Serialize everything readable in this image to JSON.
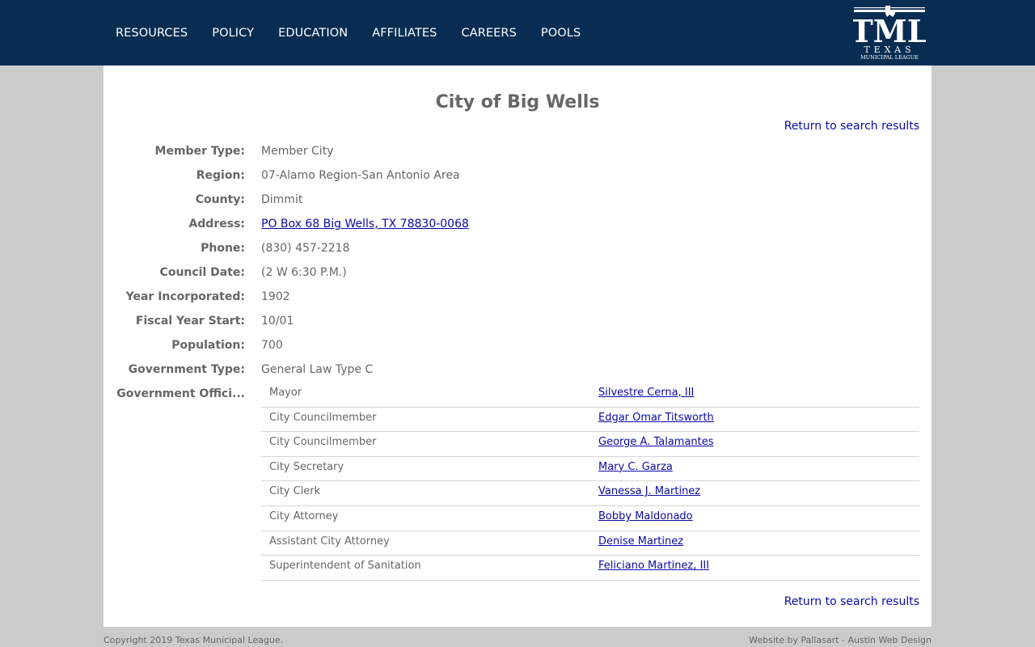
{
  "nav": {
    "items": [
      "RESOURCES",
      "POLICY",
      "EDUCATION",
      "AFFILIATES",
      "CAREERS",
      "POOLS"
    ]
  },
  "logo": {
    "main": "TML",
    "state": "TEXAS",
    "sub": "MUNICIPAL LEAGUE"
  },
  "page": {
    "title": "City of Big Wells",
    "return_link": "Return to search results"
  },
  "details": [
    {
      "label": "Member Type:",
      "value": "Member City"
    },
    {
      "label": "Region:",
      "value": "07-Alamo Region-San Antonio Area"
    },
    {
      "label": "County:",
      "value": "Dimmit"
    },
    {
      "label": "Address:",
      "value": "PO Box 68 Big Wells, TX 78830-0068"
    },
    {
      "label": "Phone:",
      "value": "(830) 457-2218"
    },
    {
      "label": "Council Date:",
      "value": "(2 W 6:30 P.M.)"
    },
    {
      "label": "Year Incorporated:",
      "value": "1902"
    },
    {
      "label": "Fiscal Year Start:",
      "value": "10/01"
    },
    {
      "label": "Population:",
      "value": "700"
    },
    {
      "label": "Government Type:",
      "value": "General Law Type C"
    },
    {
      "label": "Government Offici..."
    }
  ],
  "officials": [
    {
      "role": "Mayor",
      "name": "Silvestre Cerna, III"
    },
    {
      "role": "City Councilmember",
      "name": "Edgar Omar Titsworth"
    },
    {
      "role": "City Councilmember",
      "name": "George A. Talamantes"
    },
    {
      "role": "City Secretary",
      "name": "Mary C. Garza"
    },
    {
      "role": "City Clerk",
      "name": "Vanessa J. Martinez"
    },
    {
      "role": "City Attorney",
      "name": "Bobby Maldonado"
    },
    {
      "role": "Assistant City Attorney",
      "name": "Denise Martinez"
    },
    {
      "role": "Superintendent of Sanitation",
      "name": "Feliciano Martinez, III"
    }
  ],
  "footer": {
    "copyright": "Copyright 2019 Texas Municipal League.",
    "credit": "Website by Pallasart - Austin Web Design"
  },
  "colors": {
    "header_bg": "#082d52",
    "link": "#0a0aa6",
    "text": "#666666",
    "page_bg": "#cbcbcb"
  }
}
